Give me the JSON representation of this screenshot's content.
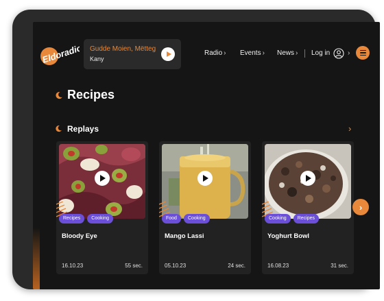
{
  "brand": {
    "logo_text": "Eldoradio"
  },
  "now_playing": {
    "title": "Gudde Moien, Mëtteg",
    "subtitle": "Kany"
  },
  "nav": {
    "items": [
      {
        "label": "Radio"
      },
      {
        "label": "Events"
      },
      {
        "label": "News"
      }
    ],
    "login_label": "Log in"
  },
  "page": {
    "title": "Recipes"
  },
  "section": {
    "title": "Replays"
  },
  "cards": [
    {
      "title": "Bloody Eye",
      "date": "16.10.23",
      "duration": "55 sec.",
      "tags": [
        "Recipes",
        "Cooking"
      ]
    },
    {
      "title": "Mango Lassi",
      "date": "05.10.23",
      "duration": "24 sec.",
      "tags": [
        "Food",
        "Cooking"
      ]
    },
    {
      "title": "Yoghurt Bowl",
      "date": "16.08.23",
      "duration": "31 sec.",
      "tags": [
        "Cooking",
        "Recipes"
      ]
    }
  ],
  "colors": {
    "accent": "#e8883a",
    "tag": "#6b4fd8",
    "background": "#151515",
    "card": "#222222"
  }
}
